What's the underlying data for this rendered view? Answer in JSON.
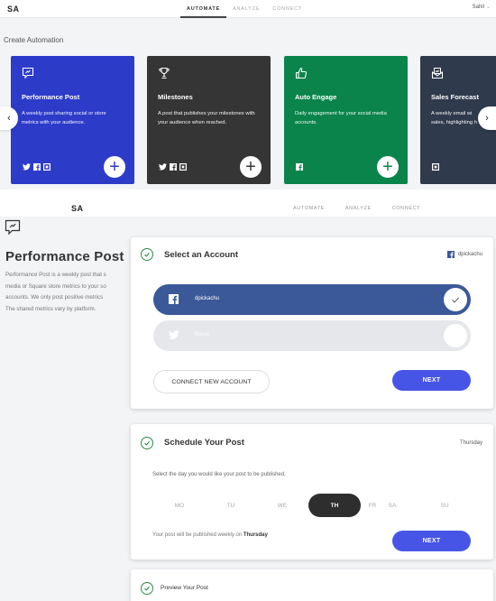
{
  "topbar": {
    "logo": "SA",
    "tabs": [
      {
        "label": "AUTOMATE",
        "active": true
      },
      {
        "label": "ANALYZE",
        "active": false
      },
      {
        "label": "CONNECT",
        "active": false
      }
    ],
    "user": "Sahil",
    "user_chevron": "⌄"
  },
  "section_title": "Create Automation",
  "carousel": {
    "prev_arrow": "‹",
    "next_arrow": "›",
    "cards": [
      {
        "title": "Performance Post",
        "description": "A weekly post sharing social or store metrics with your audience.",
        "icon": "chart-chat-icon",
        "color": "#2d3bc9",
        "platforms": [
          "twitter",
          "facebook",
          "square"
        ],
        "add_label": "+"
      },
      {
        "title": "Milestones",
        "description": "A post that publishes your milestones with your audience when reached.",
        "icon": "trophy-icon",
        "color": "#353535",
        "platforms": [
          "twitter",
          "facebook",
          "square"
        ],
        "add_label": "+"
      },
      {
        "title": "Auto Engage",
        "description": "Daily engagement for your social media accounts.",
        "icon": "thumbs-up-icon",
        "color": "#0a844b",
        "platforms": [
          "facebook"
        ],
        "add_label": "+"
      },
      {
        "title": "Sales Forecast",
        "description_line1": "A weekly email wi",
        "description_line2": "sales, highlighting h",
        "icon": "envelope-chart-icon",
        "color": "#2f3a4c",
        "platforms": [
          "square"
        ]
      }
    ]
  },
  "detail": {
    "topbar": {
      "logo": "SA",
      "tabs": [
        "AUTOMATE",
        "ANALYZE",
        "CONNECT"
      ]
    },
    "title": "Performance Post",
    "description_lines": [
      "Performance Post is a weekly post that s",
      "media or Square store metrics to your so",
      "accounts. We only post positive metrics",
      "The shared metrics vary by platform."
    ],
    "select_account": {
      "title": "Select an Account",
      "selected_summary": "dpickachu",
      "accounts": [
        {
          "platform": "facebook",
          "name": "dpickachu",
          "selected": true
        },
        {
          "platform": "twitter",
          "name": "lfstest",
          "selected": false
        }
      ],
      "connect_button": "CONNECT NEW ACCOUNT",
      "next_button": "NEXT"
    },
    "schedule": {
      "title": "Schedule Your Post",
      "selected_summary": "Thursday",
      "prompt": "Select the day you would like your post to be published.",
      "days": [
        "MO",
        "TU",
        "WE",
        "TH",
        "FR",
        "SA",
        "SU"
      ],
      "selected_day": "TH",
      "note_prefix": "Your post will be published weekly on ",
      "note_day": "Thursday",
      "next_button": "NEXT"
    },
    "preview": {
      "title": "Preview Your Post"
    }
  },
  "colors": {
    "accent": "#4655e6",
    "success": "#2b8a4b",
    "facebook": "#3b5998"
  }
}
